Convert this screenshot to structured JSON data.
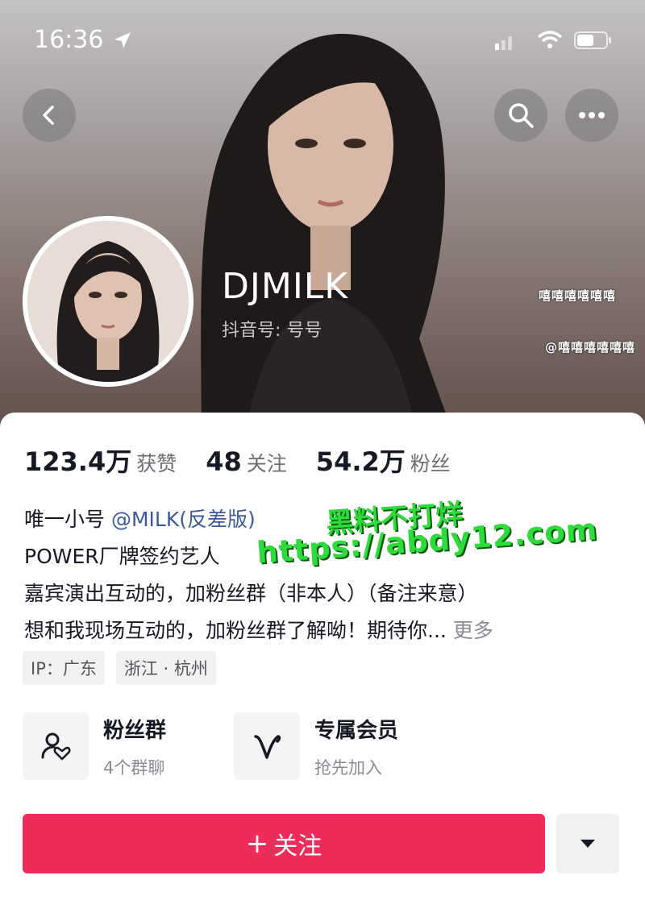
{
  "status_bar": {
    "time": "16:36"
  },
  "profile": {
    "username": "DJMILK",
    "douyin_id": "抖音号: 号号",
    "side_stickers": [
      "嘻嘻嘻嘻嘻嘻",
      "@嘻嘻嘻嘻嘻嘻"
    ]
  },
  "stats": [
    {
      "value": "123.4万",
      "label": "获赞"
    },
    {
      "value": "48",
      "label": "关注"
    },
    {
      "value": "54.2万",
      "label": "粉丝"
    }
  ],
  "bio": {
    "line1_prefix": "唯一小号",
    "line1_mention": "@MILK(反差版)",
    "line2": "POWER厂牌签约艺人",
    "line3": "嘉宾演出互动的，加粉丝群（非本人）（备注来意）",
    "line4": "想和我现场互动的，加粉丝群了解呦！期待你...",
    "more": "更多"
  },
  "tags": [
    "IP：广东",
    "浙江 · 杭州"
  ],
  "watermark": {
    "line1": "黑料不打烊",
    "line2": "https://abdy12.com"
  },
  "features": {
    "fans_group": {
      "title": "粉丝群",
      "subtitle": "4个群聊",
      "icon": "fans-group-icon"
    },
    "membership": {
      "title": "专属会员",
      "subtitle": "抢先加入",
      "icon": "membership-v-icon"
    }
  },
  "actions": {
    "follow_plus": "+",
    "follow_label": "关注"
  },
  "colors": {
    "accent": "#ee2c5a",
    "watermark": "#2ddb3a",
    "mention": "#3b5b9a"
  }
}
